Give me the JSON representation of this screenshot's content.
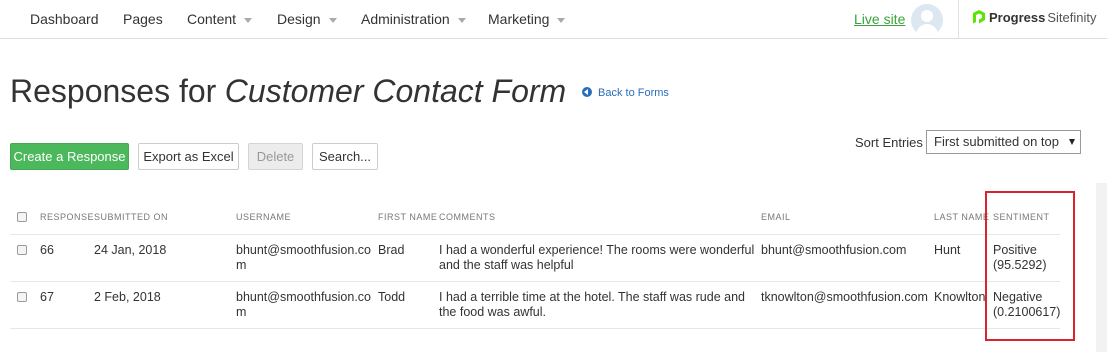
{
  "topnav": {
    "items": [
      {
        "label": "Dashboard",
        "has_menu": false
      },
      {
        "label": "Pages",
        "has_menu": false
      },
      {
        "label": "Content",
        "has_menu": true
      },
      {
        "label": "Design",
        "has_menu": true
      },
      {
        "label": "Administration",
        "has_menu": true
      },
      {
        "label": "Marketing",
        "has_menu": true
      }
    ],
    "live_site": "Live site",
    "avatar_icon": "user-icon",
    "brand_strong": "Progress",
    "brand_light": "Sitefinity"
  },
  "page": {
    "title_prefix": "Responses for",
    "title_form": "Customer Contact Form",
    "back_link": "Back to Forms"
  },
  "toolbar": {
    "create": "Create a Response",
    "export": "Export as Excel",
    "delete": "Delete",
    "search": "Search...",
    "sort_label": "Sort Entries",
    "sort_value": "First submitted on top"
  },
  "table": {
    "headers": [
      "RESPONSE",
      "SUBMITTED ON",
      "USERNAME",
      "FIRST NAME",
      "COMMENTS",
      "EMAIL",
      "LAST NAME",
      "SENTIMENT"
    ],
    "rows": [
      {
        "response": "66",
        "submitted": "24 Jan, 2018",
        "username": [
          "bhunt@smoothfusion.co",
          "m"
        ],
        "first": "Brad",
        "comments": [
          "I had a wonderful experience! The rooms were wonderful",
          "and the staff was helpful"
        ],
        "email": "bhunt@smoothfusion.com",
        "last": "Hunt",
        "sentiment": [
          "Positive",
          "(95.5292)"
        ]
      },
      {
        "response": "67",
        "submitted": "2 Feb, 2018",
        "username": [
          "bhunt@smoothfusion.co",
          "m"
        ],
        "first": "Todd",
        "comments": [
          "I had a terrible time at the hotel. The staff was rude and",
          "the food was awful."
        ],
        "email": "tknowlton@smoothfusion.com",
        "last": "Knowlton",
        "sentiment": [
          "Negative",
          "(0.2100617)"
        ]
      }
    ]
  },
  "colors": {
    "primary_button": "#4cb85c",
    "link": "#2a6ebb",
    "live_site": "#3aa33a",
    "highlight_box": "#d9232e"
  }
}
